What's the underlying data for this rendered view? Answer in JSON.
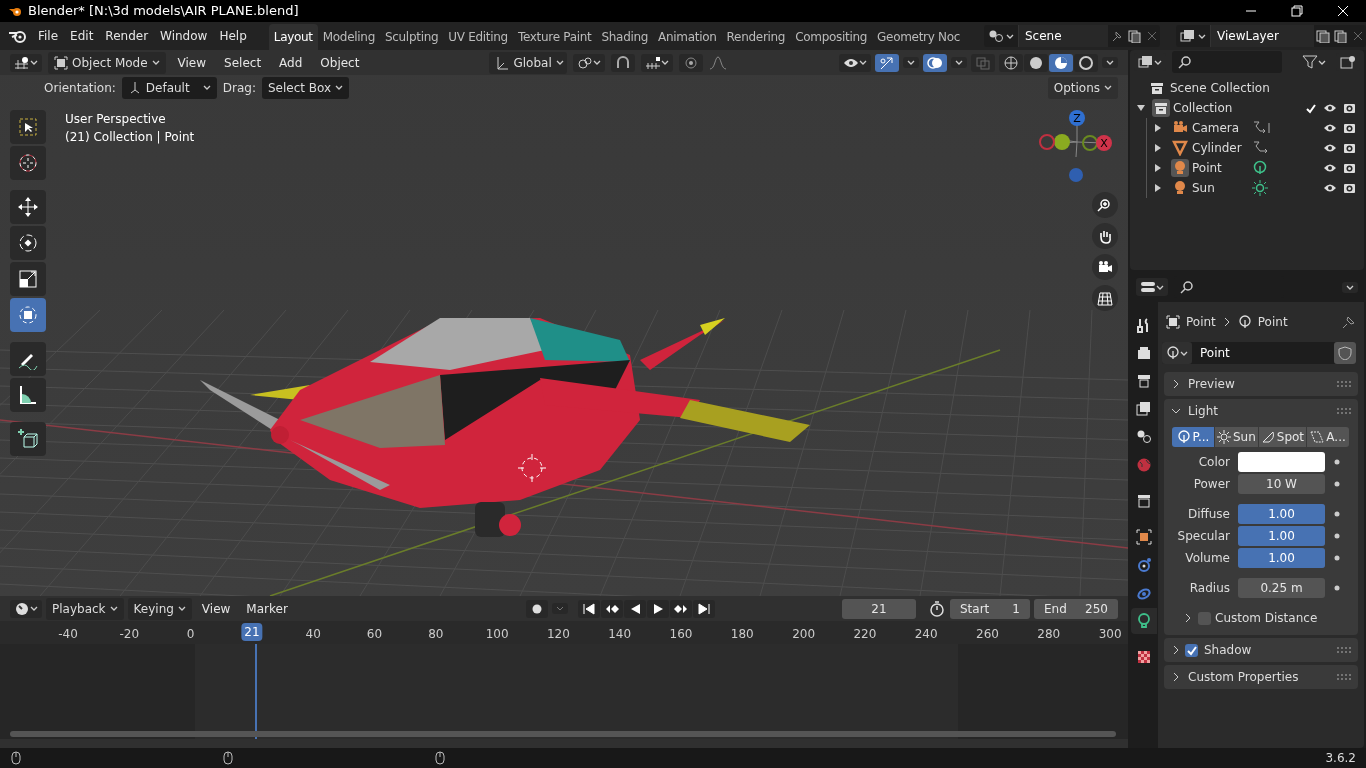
{
  "window": {
    "title": "Blender* [N:\\3d models\\AIR PLANE.blend]"
  },
  "menus": [
    "File",
    "Edit",
    "Render",
    "Window",
    "Help"
  ],
  "workspaces": [
    {
      "label": "Layout",
      "selected": true
    },
    {
      "label": "Modeling",
      "selected": false
    },
    {
      "label": "Sculpting",
      "selected": false
    },
    {
      "label": "UV Editing",
      "selected": false
    },
    {
      "label": "Texture Paint",
      "selected": false
    },
    {
      "label": "Shading",
      "selected": false
    },
    {
      "label": "Animation",
      "selected": false
    },
    {
      "label": "Rendering",
      "selected": false
    },
    {
      "label": "Compositing",
      "selected": false
    },
    {
      "label": "Geometry Noc",
      "selected": false
    }
  ],
  "scene": {
    "value": "Scene"
  },
  "view_layer": {
    "value": "ViewLayer"
  },
  "viewport_header": {
    "mode": "Object Mode",
    "menus": [
      "View",
      "Select",
      "Add",
      "Object"
    ],
    "transform": "Global"
  },
  "tool_settings": {
    "orientation_label": "Orientation:",
    "orientation": "Default",
    "drag_label": "Drag:",
    "drag": "Select Box",
    "options": "Options"
  },
  "viewport": {
    "overlay": [
      "User Perspective",
      "(21) Collection | Point"
    ],
    "tools": [
      {
        "kind": "select",
        "selected": false
      },
      {
        "kind": "cursor",
        "selected": false
      },
      {
        "kind": "move",
        "selected": false
      },
      {
        "kind": "rotate",
        "selected": false
      },
      {
        "kind": "scale",
        "selected": false
      },
      {
        "kind": "transform",
        "selected": true
      },
      {
        "kind": "annotate",
        "selected": false
      },
      {
        "kind": "measure",
        "selected": false
      },
      {
        "kind": "addcube",
        "selected": false
      }
    ],
    "gizmo": {
      "z": "Z",
      "x": "X"
    }
  },
  "outliner": {
    "root": "Scene Collection",
    "items": [
      {
        "label": "Collection",
        "expanded": true,
        "checked": true,
        "children": [
          {
            "label": "Camera",
            "kind": "camera",
            "selected": false
          },
          {
            "label": "Cylinder",
            "kind": "mesh",
            "selected": false
          },
          {
            "label": "Point",
            "kind": "pointlight",
            "selected": true
          },
          {
            "label": "Sun",
            "kind": "sunlight",
            "selected": false
          }
        ]
      }
    ]
  },
  "properties": {
    "breadcrumb": [
      "Point",
      "Point"
    ],
    "datablock": "Point",
    "tabs": [
      {
        "kind": "tool",
        "selected": false
      },
      {
        "kind": "render",
        "selected": false
      },
      {
        "kind": "output",
        "selected": false
      },
      {
        "kind": "viewlayer",
        "selected": false
      },
      {
        "kind": "scene",
        "selected": false
      },
      {
        "kind": "world",
        "selected": false
      },
      {
        "kind": "collection",
        "selected": false
      },
      {
        "kind": "object",
        "selected": false
      },
      {
        "kind": "physics",
        "selected": false
      },
      {
        "kind": "constraints",
        "selected": false
      },
      {
        "kind": "data",
        "selected": true
      },
      {
        "kind": "texture",
        "selected": false
      }
    ],
    "preview": {
      "label": "Preview",
      "expanded": false
    },
    "light": {
      "label": "Light",
      "expanded": true,
      "types": [
        {
          "label": "P...",
          "kind": "point",
          "selected": true
        },
        {
          "label": "Sun",
          "kind": "sun",
          "selected": false
        },
        {
          "label": "Spot",
          "kind": "spot",
          "selected": false
        },
        {
          "label": "A...",
          "kind": "area",
          "selected": false
        }
      ],
      "fields": [
        {
          "label": "Color",
          "kind": "color",
          "color": "#ffffff"
        },
        {
          "label": "Power",
          "kind": "number",
          "value": "10 W"
        },
        {
          "label": "Diffuse",
          "kind": "slider",
          "value": "1.00",
          "level": 1
        },
        {
          "label": "Specular",
          "kind": "slider",
          "value": "1.00",
          "level": 1
        },
        {
          "label": "Volume",
          "kind": "slider",
          "value": "1.00",
          "level": 1
        },
        {
          "label": "Radius",
          "kind": "number",
          "value": "0.25 m"
        }
      ],
      "custom_distance": {
        "label": "Custom Distance",
        "checked": false
      }
    },
    "shadow": {
      "label": "Shadow",
      "checked": true,
      "expanded": false
    },
    "custom_properties": {
      "label": "Custom Properties",
      "expanded": false
    }
  },
  "timeline": {
    "menus": [
      "Playback",
      "Keying",
      "View",
      "Marker"
    ],
    "current_frame": "21",
    "start_label": "Start",
    "start": "1",
    "end_label": "End",
    "end": "250",
    "ruler": [
      "-40",
      "-20",
      "0",
      "21",
      "40",
      "60",
      "80",
      "100",
      "120",
      "140",
      "160",
      "180",
      "200",
      "220",
      "240",
      "260",
      "280",
      "300"
    ]
  },
  "status_bar": {
    "version": "3.6.2"
  }
}
